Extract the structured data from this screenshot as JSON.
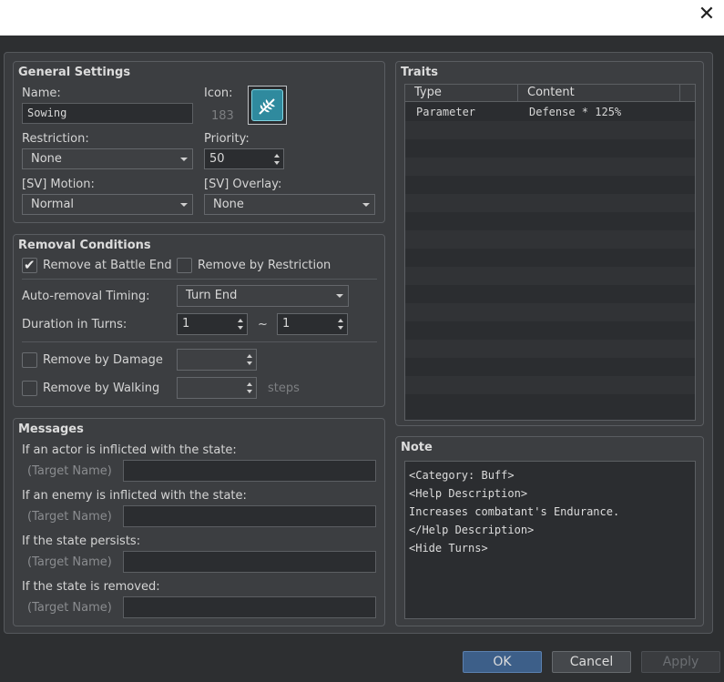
{
  "window": {
    "close_glyph": "✕"
  },
  "general": {
    "title": "General Settings",
    "name_label": "Name:",
    "name_value": "Sowing",
    "icon_label": "Icon:",
    "icon_index": "183",
    "icon_name": "leaf-sprig-icon",
    "restriction_label": "Restriction:",
    "restriction_value": "None",
    "priority_label": "Priority:",
    "priority_value": "50",
    "motion_label": "[SV] Motion:",
    "motion_value": "Normal",
    "overlay_label": "[SV] Overlay:",
    "overlay_value": "None"
  },
  "removal": {
    "title": "Removal Conditions",
    "remove_battle_end_label": "Remove at Battle End",
    "remove_battle_end_checked": true,
    "remove_by_restriction_label": "Remove by Restriction",
    "remove_by_restriction_checked": false,
    "auto_removal_label": "Auto-removal Timing:",
    "auto_removal_value": "Turn End",
    "duration_label": "Duration in Turns:",
    "duration_min": "1",
    "duration_tilde": "~",
    "duration_max": "1",
    "remove_by_damage_label": "Remove by Damage",
    "remove_by_damage_checked": false,
    "remove_by_damage_value": "",
    "remove_by_walking_label": "Remove by Walking",
    "remove_by_walking_checked": false,
    "remove_by_walking_value": "",
    "steps_label": "steps"
  },
  "messages": {
    "title": "Messages",
    "target_placeholder": "(Target Name)",
    "items": [
      {
        "label": "If an actor is inflicted with the state:",
        "value": ""
      },
      {
        "label": "If an enemy is inflicted with the state:",
        "value": ""
      },
      {
        "label": "If the state persists:",
        "value": ""
      },
      {
        "label": "If the state is removed:",
        "value": ""
      }
    ]
  },
  "traits": {
    "title": "Traits",
    "columns": [
      "Type",
      "Content"
    ],
    "rows": [
      {
        "type": "Parameter",
        "content": "Defense * 125%"
      }
    ]
  },
  "note": {
    "title": "Note",
    "lines": [
      "<Category: Buff>",
      "<Help Description>",
      "Increases combatant's Endurance.",
      "</Help Description>",
      "<Hide Turns>"
    ]
  },
  "buttons": {
    "ok": "OK",
    "cancel": "Cancel",
    "apply": "Apply"
  },
  "colors": {
    "background": "#3a3c3f",
    "field": "#2b2d30",
    "primary_button": "#3d5f89",
    "icon": "#2f8a9e"
  }
}
